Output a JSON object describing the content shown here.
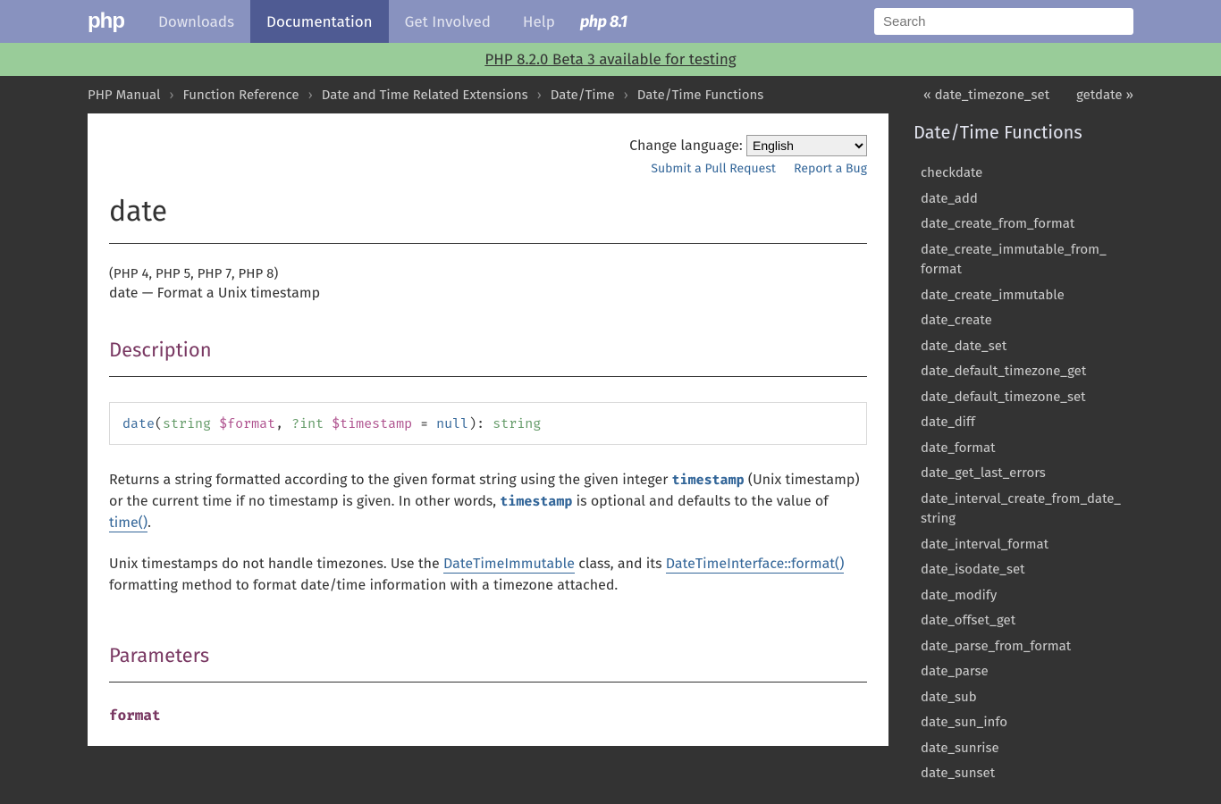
{
  "topnav": {
    "logo": "php",
    "links": [
      {
        "label": "Downloads",
        "active": false
      },
      {
        "label": "Documentation",
        "active": true
      },
      {
        "label": "Get Involved",
        "active": false
      },
      {
        "label": "Help",
        "active": false
      }
    ],
    "php81": "php 8.1",
    "searchPlaceholder": "Search"
  },
  "banner": {
    "text": "PHP 8.2.0 Beta 3 available for testing"
  },
  "breadcrumbs": [
    "PHP Manual",
    "Function Reference",
    "Date and Time Related Extensions",
    "Date/Time",
    "Date/Time Functions"
  ],
  "pagenav": {
    "prev": "« date_timezone_set",
    "next": "getdate »"
  },
  "langbar": {
    "label": "Change language:",
    "selected": "English"
  },
  "actions": {
    "pr": "Submit a Pull Request",
    "bug": "Report a Bug"
  },
  "title": "date",
  "verinfo": "(PHP 4, PHP 5, PHP 7, PHP 8)",
  "refpurpose": "date — Format a Unix timestamp",
  "sect_description": "Description",
  "synopsis": {
    "fn": "date",
    "open": "(",
    "t1": "string",
    "v1": "$format",
    "comma": ", ",
    "t2": "?int",
    "v2": "$timestamp",
    "eq": " = ",
    "def": "null",
    "close": "): ",
    "ret": "string"
  },
  "desc1a": "Returns a string formatted according to the given format string using the given integer ",
  "desc1_code1": "timestamp",
  "desc1b": " (Unix timestamp) or the current time if no timestamp is given. In other words, ",
  "desc1_code2": "timestamp",
  "desc1c": " is optional and defaults to the value of ",
  "desc1_link": "time()",
  "desc1d": ".",
  "desc2a": "Unix timestamps do not handle timezones. Use the ",
  "desc2_link1": "DateTimeImmutable",
  "desc2b": " class, and its ",
  "desc2_link2": "DateTimeInterface::format()",
  "desc2c": " formatting method to format date/time information with a timezone attached.",
  "sect_parameters": "Parameters",
  "param1": "format",
  "sidebar": {
    "title": "Date/Time Functions",
    "items": [
      "checkdate",
      "date_add",
      "date_create_from_format",
      "date_create_immutable_from_format",
      "date_create_immutable",
      "date_create",
      "date_date_set",
      "date_default_timezone_get",
      "date_default_timezone_set",
      "date_diff",
      "date_format",
      "date_get_last_errors",
      "date_interval_create_from_date_string",
      "date_interval_format",
      "date_isodate_set",
      "date_modify",
      "date_offset_get",
      "date_parse_from_format",
      "date_parse",
      "date_sub",
      "date_sun_info",
      "date_sunrise",
      "date_sunset"
    ]
  }
}
